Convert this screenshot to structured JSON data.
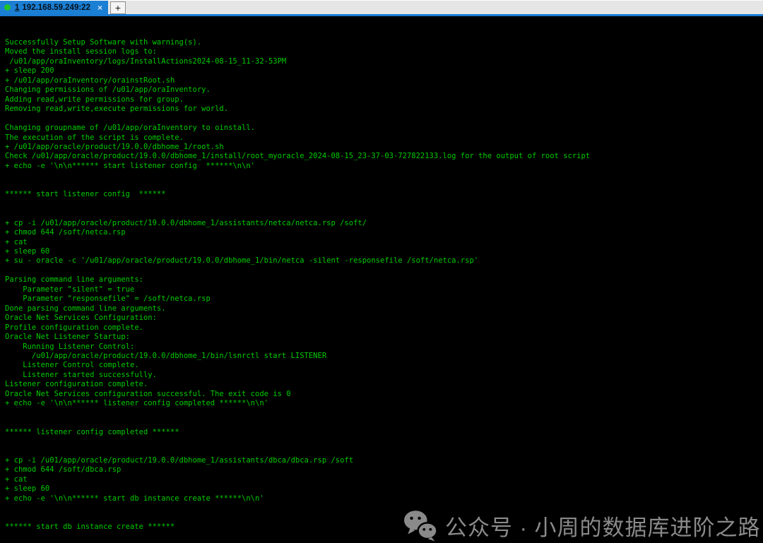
{
  "tab_bar": {
    "active_tab": {
      "index": "1",
      "label": "192.168.59.249:22",
      "close_label": "×",
      "status_color": "#21c32b",
      "background_color": "#1b7fd4"
    },
    "new_tab_label": "+"
  },
  "terminal": {
    "fg_color": "#00cb00",
    "bg_color": "#000000",
    "lines": [
      "Successfully Setup Software with warning(s).",
      "Moved the install session logs to:",
      " /u01/app/oraInventory/logs/InstallActions2024-08-15_11-32-53PM",
      "+ sleep 200",
      "+ /u01/app/oraInventory/orainstRoot.sh",
      "Changing permissions of /u01/app/oraInventory.",
      "Adding read,write permissions for group.",
      "Removing read,write,execute permissions for world.",
      "",
      "Changing groupname of /u01/app/oraInventory to oinstall.",
      "The execution of the script is complete.",
      "+ /u01/app/oracle/product/19.0.0/dbhome_1/root.sh",
      "Check /u01/app/oracle/product/19.0.0/dbhome_1/install/root_myoracle_2024-08-15_23-37-03-727822133.log for the output of root script",
      "+ echo -e '\\n\\n****** start listener config  ******\\n\\n'",
      "",
      "",
      "****** start listener config  ******",
      "",
      "",
      "+ cp -i /u01/app/oracle/product/19.0.0/dbhome_1/assistants/netca/netca.rsp /soft/",
      "+ chmod 644 /soft/netca.rsp",
      "+ cat",
      "+ sleep 60",
      "+ su - oracle -c '/u01/app/oracle/product/19.0.0/dbhome_1/bin/netca -silent -responsefile /soft/netca.rsp'",
      "",
      "Parsing command line arguments:",
      "    Parameter \"silent\" = true",
      "    Parameter \"responsefile\" = /soft/netca.rsp",
      "Done parsing command line arguments.",
      "Oracle Net Services Configuration:",
      "Profile configuration complete.",
      "Oracle Net Listener Startup:",
      "    Running Listener Control:",
      "      /u01/app/oracle/product/19.0.0/dbhome_1/bin/lsnrctl start LISTENER",
      "    Listener Control complete.",
      "    Listener started successfully.",
      "Listener configuration complete.",
      "Oracle Net Services configuration successful. The exit code is 0",
      "+ echo -e '\\n\\n****** listener config completed ******\\n\\n'",
      "",
      "",
      "****** listener config completed ******",
      "",
      "",
      "+ cp -i /u01/app/oracle/product/19.0.0/dbhome_1/assistants/dbca/dbca.rsp /soft",
      "+ chmod 644 /soft/dbca.rsp",
      "+ cat",
      "+ sleep 60",
      "+ echo -e '\\n\\n****** start db instance create ******\\n\\n'",
      "",
      "",
      "****** start db instance create ******"
    ]
  },
  "watermark": {
    "icon": "wechat-icon",
    "text": "公众号 · 小周的数据库进阶之路",
    "color": "#8a8a8a"
  }
}
